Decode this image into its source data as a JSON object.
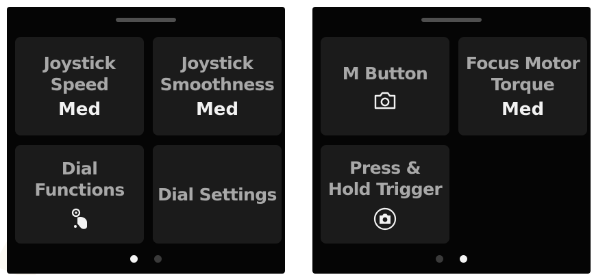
{
  "screens": [
    {
      "tiles": [
        {
          "title": "Joystick\nSpeed",
          "value": "Med"
        },
        {
          "title": "Joystick\nSmoothness",
          "value": "Med"
        },
        {
          "title": "Dial\nFunctions",
          "value": "",
          "icon": "dial-hand-icon"
        },
        {
          "title": "Dial Settings",
          "value": ""
        }
      ],
      "page_dots": {
        "count": 2,
        "active": 1
      }
    },
    {
      "tiles": [
        {
          "title": "M Button",
          "value": "",
          "icon": "camera-icon"
        },
        {
          "title": "Focus Motor\nTorque",
          "value": "Med"
        },
        {
          "title": "Press &\nHold Trigger",
          "value": "",
          "icon": "camera-circle-icon"
        }
      ],
      "page_dots": {
        "count": 2,
        "active": 2
      }
    }
  ],
  "colors": {
    "screen_bg": "#050505",
    "tile_bg": "#1b1b1b",
    "title_text": "#a8a8a8",
    "value_text": "#f2f2f2",
    "dot_active": "#f5f5f5",
    "dot_inactive": "#3a3a3a"
  }
}
